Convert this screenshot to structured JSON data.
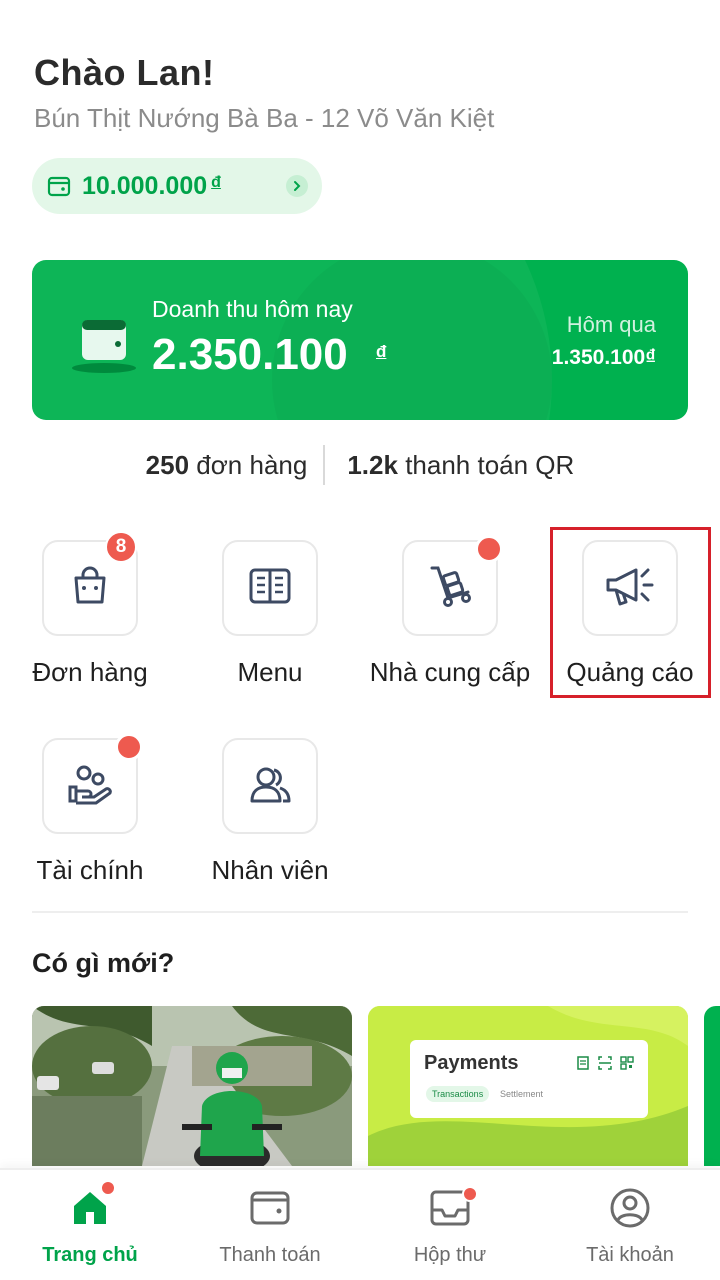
{
  "header": {
    "greeting": "Chào Lan!",
    "store": "Bún Thịt Nướng Bà Ba - 12 Võ Văn Kiệt"
  },
  "wallet": {
    "amount": "10.000.000",
    "currency": "đ",
    "icon": "wallet-icon"
  },
  "revenue": {
    "label": "Doanh thu hôm nay",
    "value": "2.350.100",
    "currency": "đ",
    "yesterday_label": "Hôm qua",
    "yesterday_value": "1.350.100₫"
  },
  "stats": {
    "orders_count": "250",
    "orders_label": "đơn hàng",
    "qr_count": "1.2k",
    "qr_label": "thanh toán QR"
  },
  "shortcuts": [
    {
      "label": "Đơn hàng",
      "icon": "shopping-bag-icon",
      "badge": "8"
    },
    {
      "label": "Menu",
      "icon": "menu-book-icon"
    },
    {
      "label": "Nhà cung cấp",
      "icon": "hand-truck-icon",
      "dot": true
    },
    {
      "label": "Quảng cáo",
      "icon": "megaphone-icon",
      "highlighted": true
    },
    {
      "label": "Tài chính",
      "icon": "finance-hand-icon",
      "dot": true
    },
    {
      "label": "Nhân viên",
      "icon": "staff-icon"
    }
  ],
  "news": {
    "title": "Có gì mới?",
    "payments_card": {
      "title": "Payments",
      "tab_active": "Transactions",
      "tab_inactive": "Settlement"
    }
  },
  "bottom_nav": [
    {
      "label": "Trang chủ",
      "icon": "home-icon",
      "active": true,
      "dot": true
    },
    {
      "label": "Thanh toán",
      "icon": "wallet-icon"
    },
    {
      "label": "Hộp thư",
      "icon": "inbox-icon",
      "dot": true
    },
    {
      "label": "Tài khoản",
      "icon": "account-icon"
    }
  ],
  "colors": {
    "brand": "#00b14f",
    "badge": "#ee5a4f",
    "highlight": "#d6202a"
  }
}
